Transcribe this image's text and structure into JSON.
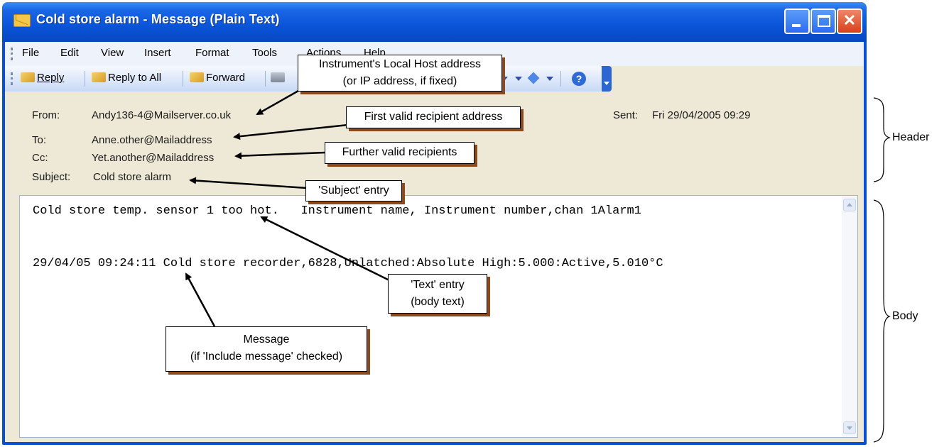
{
  "window": {
    "title": "Cold store alarm - Message (Plain Text)",
    "accent": "#0a54d8",
    "buttons": {
      "minimize": "minimize",
      "maximize": "maximize",
      "close": "✕"
    }
  },
  "menu": [
    "File",
    "Edit",
    "View",
    "Insert",
    "Format",
    "Tools",
    "Actions",
    "Help"
  ],
  "toolbar": {
    "reply": "Reply",
    "reply_all": "Reply to All",
    "forward": "Forward"
  },
  "header": {
    "from_label": "From:",
    "from_value": "Andy136-4@Mailserver.co.uk",
    "to_label": "To:",
    "to_value": "Anne.other@Mailaddress",
    "cc_label": "Cc:",
    "cc_value": "Yet.another@Mailaddress",
    "subject_label": "Subject:",
    "subject_value": "Cold store alarm",
    "sent_label": "Sent:",
    "sent_value": "Fri 29/04/2005 09:29"
  },
  "body": {
    "line1": "Cold store temp. sensor 1 too hot.   Instrument name, Instrument number,chan 1Alarm1",
    "line2": "29/04/05 09:24:11 Cold store recorder,6828,Unlatched:Absolute High:5.000:Active,5.010°C"
  },
  "annotations": {
    "host_line1": "Instrument's Local Host address",
    "host_line2": "(or IP address, if fixed)",
    "first_recipient": "First valid recipient address",
    "further_recipients": "Further valid recipients",
    "subject_entry": "'Subject' entry",
    "text_line1": "'Text' entry",
    "text_line2": "(body text)",
    "message_line1": "Message",
    "message_line2": "(if 'Include message' checked)",
    "header_bracket": "Header",
    "body_bracket": "Body"
  }
}
